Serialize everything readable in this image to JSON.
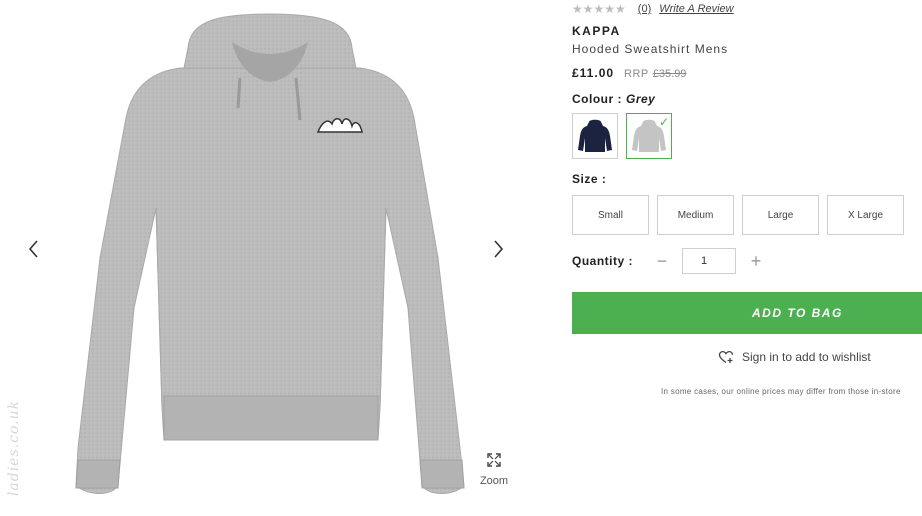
{
  "gallery": {
    "zoom_label": "Zoom",
    "watermark": "ladies.co.uk"
  },
  "product": {
    "rating_stars": "★★★★★",
    "review_count": "(0)",
    "write_review": "Write A Review",
    "brand": "KAPPA",
    "name": "Hooded Sweatshirt Mens",
    "price": "£11.00",
    "rrp_label": "RRP",
    "rrp_value": "£35.99",
    "colour_label": "Colour :",
    "colour_value": "Grey",
    "colours": [
      {
        "name": "Navy",
        "hex": "#1b2340"
      },
      {
        "name": "Grey",
        "hex": "#c9c9c9",
        "selected": true
      }
    ],
    "size_label": "Size :",
    "sizes": [
      "Small",
      "Medium",
      "Large",
      "X Large"
    ],
    "quantity_label": "Quantity :",
    "quantity_value": "1",
    "add_to_bag": "ADD TO BAG",
    "wishlist_label": "Sign in to add to wishlist",
    "disclaimer": "In some cases, our online prices may differ from those in-store"
  },
  "colors": {
    "accent_green": "#4caf50",
    "hoodie_grey": "#bdbdbd"
  }
}
